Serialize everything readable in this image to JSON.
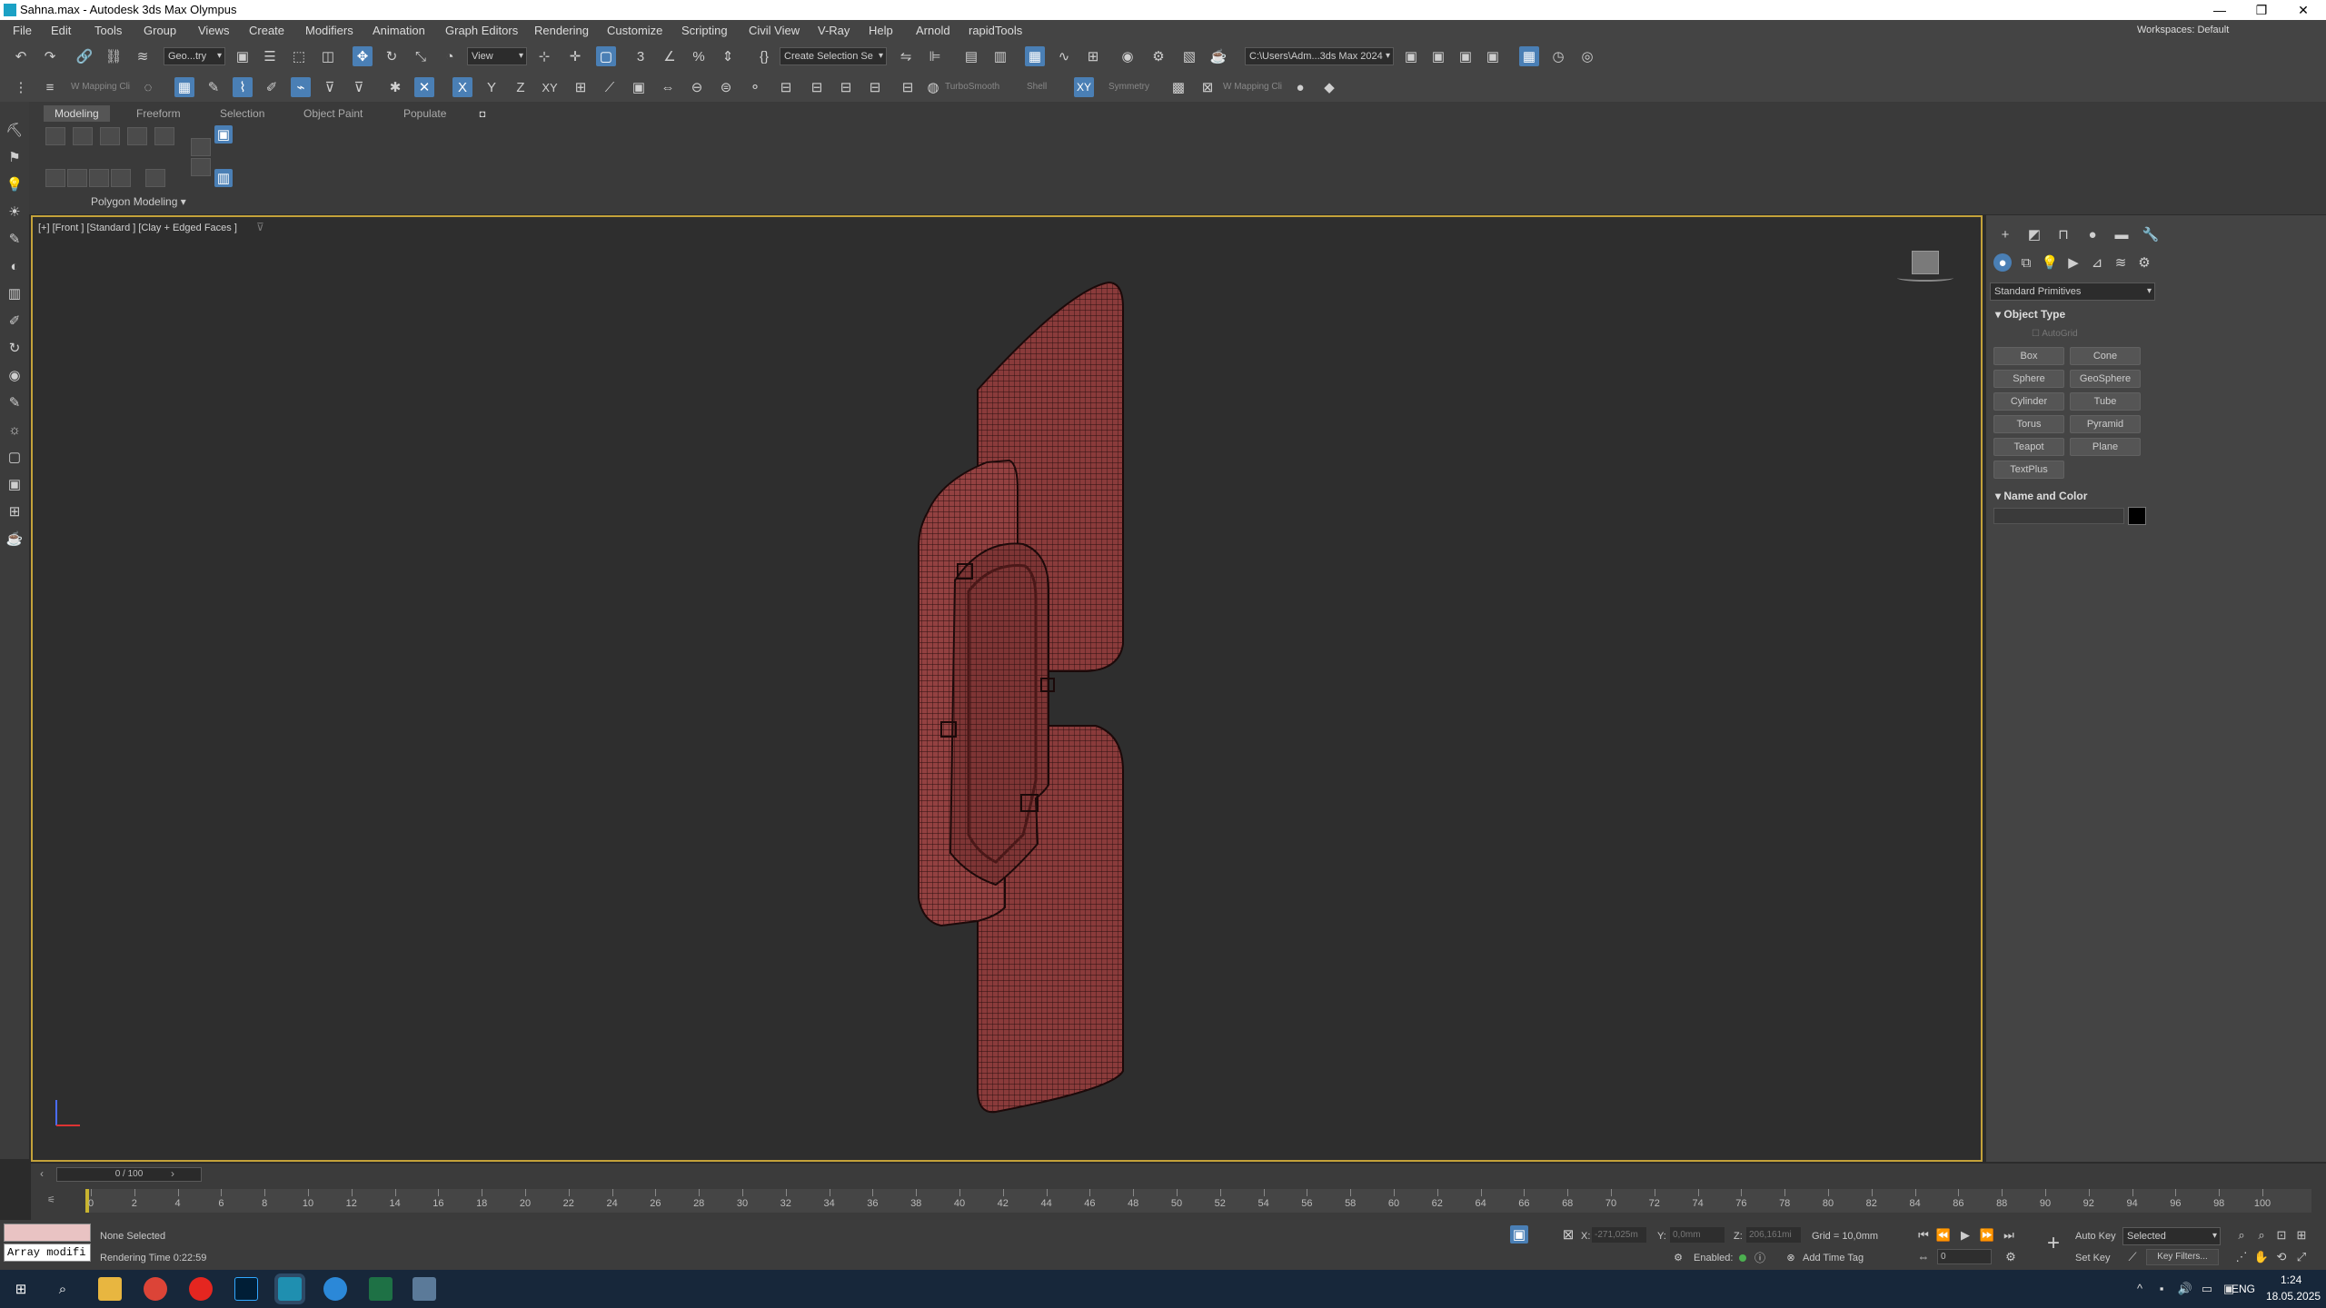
{
  "window": {
    "title": "Sahna.max - Autodesk 3ds Max Olympus",
    "min": "—",
    "restore": "❐",
    "close": "✕"
  },
  "menu": [
    "File",
    "Edit",
    "Tools",
    "Group",
    "Views",
    "Create",
    "Modifiers",
    "Animation",
    "Graph Editors",
    "Rendering",
    "Customize",
    "Scripting",
    "Civil View",
    "V-Ray",
    "Help",
    "Arnold",
    "rapidTools"
  ],
  "workspaces": {
    "label": "Workspaces:",
    "value": "Default"
  },
  "toolbar": {
    "selection_filter": "Geo...try",
    "ref_coord": "View",
    "named_selection": "Create Selection Se",
    "project_path": "C:\\Users\\Adm...3ds Max 2024",
    "axis_x": "X",
    "axis_y": "Y",
    "axis_z": "Z",
    "axis_xy": "XY",
    "axis_xy2": "XY",
    "mapping1": "W Mapping Cli",
    "mapping2": "W Mapping Cli",
    "turbosmooth": "TurboSmooth",
    "shell": "Shell",
    "symmetry": "Symmetry"
  },
  "ribbon": {
    "tabs": [
      "Modeling",
      "Freeform",
      "Selection",
      "Object Paint",
      "Populate"
    ],
    "panel_label": "Polygon Modeling"
  },
  "viewport": {
    "label": "[+] [Front ] [Standard ] [Clay + Edged Faces ]",
    "mesh_color": "#8a3b3b",
    "wire_color": "#2a0f0f"
  },
  "command_panel": {
    "category": "Standard Primitives",
    "object_type": "Object Type",
    "autogrid": "AutoGrid",
    "buttons": [
      "Box",
      "Cone",
      "Sphere",
      "GeoSphere",
      "Cylinder",
      "Tube",
      "Torus",
      "Pyramid",
      "Teapot",
      "Plane",
      "TextPlus"
    ],
    "name_color": "Name and Color",
    "swatch": "#000000"
  },
  "timeline": {
    "frame": "0 / 100",
    "ticks": [
      "0",
      "2",
      "4",
      "6",
      "8",
      "10",
      "12",
      "14",
      "16",
      "18",
      "20",
      "22",
      "24",
      "26",
      "28",
      "30",
      "32",
      "34",
      "36",
      "38",
      "40",
      "42",
      "44",
      "46",
      "48",
      "50",
      "52",
      "54",
      "56",
      "58",
      "60",
      "62",
      "64",
      "66",
      "68",
      "70",
      "72",
      "74",
      "76",
      "78",
      "80",
      "82",
      "84",
      "86",
      "88",
      "90",
      "92",
      "94",
      "96",
      "98",
      "100"
    ]
  },
  "status": {
    "maxscript": "Array modifi",
    "selection": "None Selected",
    "render_time": "Rendering Time  0:22:59",
    "x_label": "X:",
    "x_value": "-271,025m",
    "y_label": "Y:",
    "y_value": "0,0mm",
    "z_label": "Z:",
    "z_value": "206,161mi",
    "grid": "Grid = 10,0mm",
    "enabled": "Enabled:",
    "add_time_tag": "Add Time Tag",
    "autokey": "Auto Key",
    "setkey": "Set Key",
    "key_mode": "Selected",
    "key_filters": "Key Filters...",
    "frame_field": "0"
  },
  "taskbar": {
    "lang": "ENG",
    "time": "1:24",
    "date": "18.05.2025"
  }
}
